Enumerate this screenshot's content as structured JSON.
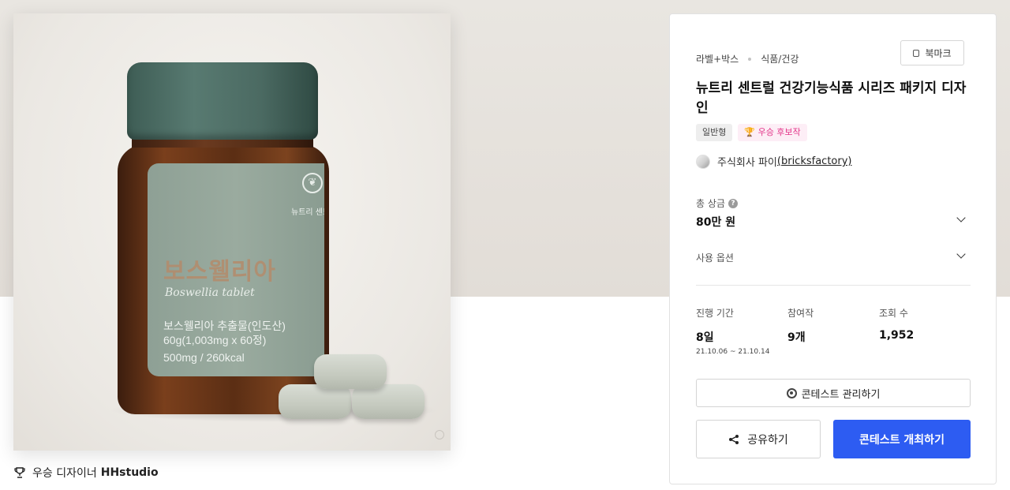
{
  "product_image": {
    "label_brand": "뉴트리 센트럴",
    "label_title": "보스웰리아",
    "label_script": "Boswellia tablet",
    "label_line1": "보스웰리아 추출물(인도산)",
    "label_line2": "60g(1,003mg x 60정)",
    "label_line3": "500mg / 260kcal"
  },
  "winner": {
    "label": "우승 디자이너",
    "name": "HHstudio"
  },
  "card": {
    "breadcrumb": [
      "라벨+박스",
      "식품/건강"
    ],
    "bookmark_label": "북마크",
    "title": "뉴트리 센트럴 건강기능식품 시리즈 패키지 디자인",
    "tags": {
      "type": "일반형",
      "winner": "🏆 우승 후보작"
    },
    "company": {
      "name": "주식회사 파이",
      "handle": "(bricksfactory)"
    },
    "prize": {
      "label": "총 상금",
      "value": "80만 원"
    },
    "usage_label": "사용 옵션",
    "stats": {
      "period": {
        "label": "진행 기간",
        "value": "8일",
        "range": "21.10.06 ~ 21.10.14"
      },
      "entries": {
        "label": "참여작",
        "value": "9개"
      },
      "views": {
        "label": "조회 수",
        "value": "1,952"
      }
    },
    "manage_label": "콘테스트 관리하기",
    "share_label": "공유하기",
    "host_label": "콘테스트 개최하기"
  },
  "colors": {
    "primary": "#2d5cf2",
    "winner_tag": "#e3368a",
    "hero_bg": "#e6e2dc"
  }
}
